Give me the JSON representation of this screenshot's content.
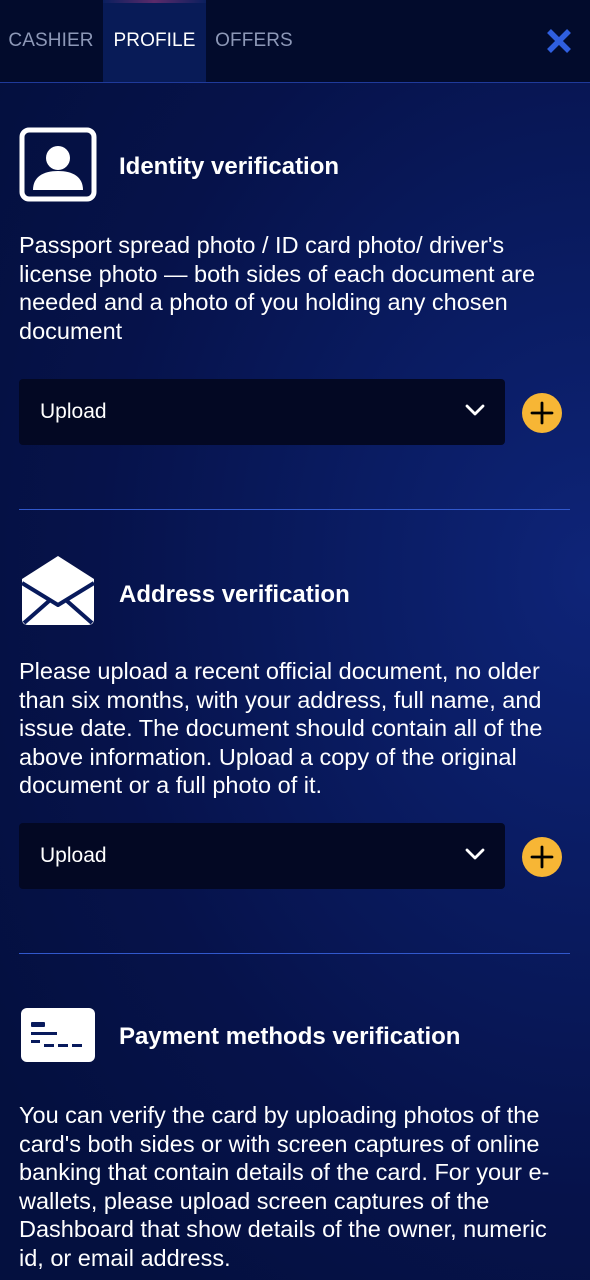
{
  "tabs": [
    {
      "label": "CASHIER",
      "active": false
    },
    {
      "label": "PROFILE",
      "active": true
    },
    {
      "label": "OFFERS",
      "active": false
    }
  ],
  "close_icon": "close-icon",
  "sections": [
    {
      "icon": "id-card-icon",
      "title": "Identity verification",
      "description": "Passport spread photo / ID card photo/ driver's license photo — both sides of each document are needed and a photo of you holding any chosen document",
      "upload_label": "Upload"
    },
    {
      "icon": "envelope-icon",
      "title": "Address verification",
      "description": "Please upload a recent official document, no older than six months, with your address, full name, and issue date. The document should contain all of the above information. Upload a copy of the original document or a full photo of it.",
      "upload_label": "Upload"
    },
    {
      "icon": "payment-card-icon",
      "title": "Payment methods verification",
      "description": "You can verify the card by uploading photos of the card's both sides or with screen captures of online banking that contain details of the card. For your e-wallets, please upload screen captures of the Dashboard that show details of the owner, numeric id, or email address."
    }
  ],
  "colors": {
    "accent": "#f7b635",
    "close": "#2f5fe0",
    "divider": "#3158cc",
    "topbar": "#020b2c"
  }
}
